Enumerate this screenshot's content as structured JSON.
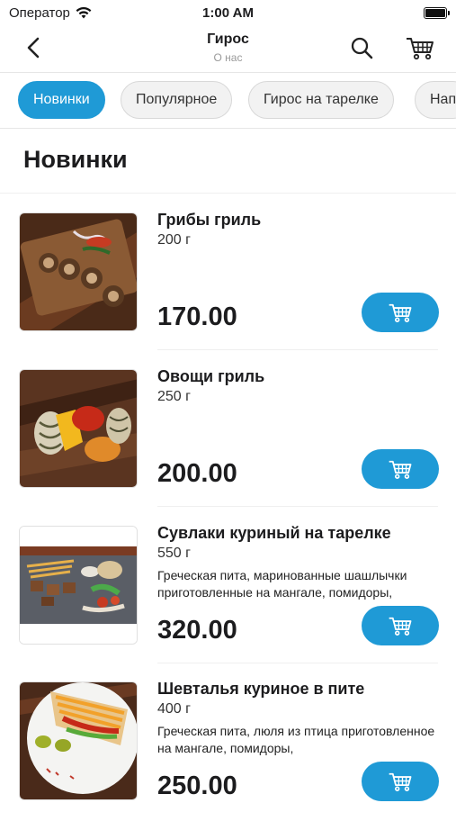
{
  "status": {
    "carrier": "Оператор",
    "time": "1:00 AM"
  },
  "nav": {
    "title": "Гирос",
    "subtitle": "О нас"
  },
  "categories": [
    {
      "label": "Новинки",
      "active": true
    },
    {
      "label": "Популярное",
      "active": false
    },
    {
      "label": "Гирос на тарелке",
      "active": false
    },
    {
      "label": "Нап",
      "active": false
    }
  ],
  "section": {
    "title": "Новинки"
  },
  "products": [
    {
      "name": "Грибы гриль",
      "weight": "200 г",
      "description": "",
      "price": "170.00"
    },
    {
      "name": "Овощи гриль",
      "weight": "250 г",
      "description": "",
      "price": "200.00"
    },
    {
      "name": "Сувлаки куриный на тарелке",
      "weight": "550 г",
      "description": "Греческая пита, маринованные шашлычки приготовленные на мангале,  помидоры,",
      "price": "320.00"
    },
    {
      "name": "Шевталья куриное в пите",
      "weight": "400 г",
      "description": "Греческая пита, люля из птица приготовленное на мангале,  помидоры,",
      "price": "250.00"
    }
  ],
  "colors": {
    "accent": "#1f9ad6"
  }
}
